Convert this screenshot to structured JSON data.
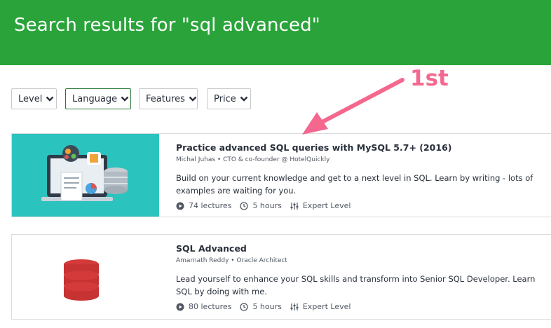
{
  "header": {
    "title": "Search results for \"sql advanced\""
  },
  "filters": [
    {
      "label": "Level"
    },
    {
      "label": "Language"
    },
    {
      "label": "Features"
    },
    {
      "label": "Price"
    }
  ],
  "annotation": {
    "label": "1st",
    "color": "#f4688f"
  },
  "courses": [
    {
      "title": "Practice advanced SQL queries with MySQL 5.7+ (2016)",
      "author": "Michal Juhas • CTO & co-founder @ HotelQuickly",
      "description": "Build on your current knowledge and get to a next level in SQL. Learn by writing - lots of examples are waiting for you.",
      "lectures": "74 lectures",
      "duration": "5 hours",
      "level": "Expert Level",
      "thumb_icon": "laptop-database-icon"
    },
    {
      "title": "SQL Advanced",
      "author": "Amarnath Reddy • Oracle Architect",
      "description": "Lead yourself to enhance your SQL skills and transform into Senior SQL Developer. Learn SQL by doing with me.",
      "lectures": "80 lectures",
      "duration": "5 hours",
      "level": "Expert Level",
      "thumb_icon": "database-icon"
    }
  ],
  "colors": {
    "header": "#2aa43a",
    "accent_thumb": "#2bc3bd",
    "db_red": "#d43a3a"
  }
}
